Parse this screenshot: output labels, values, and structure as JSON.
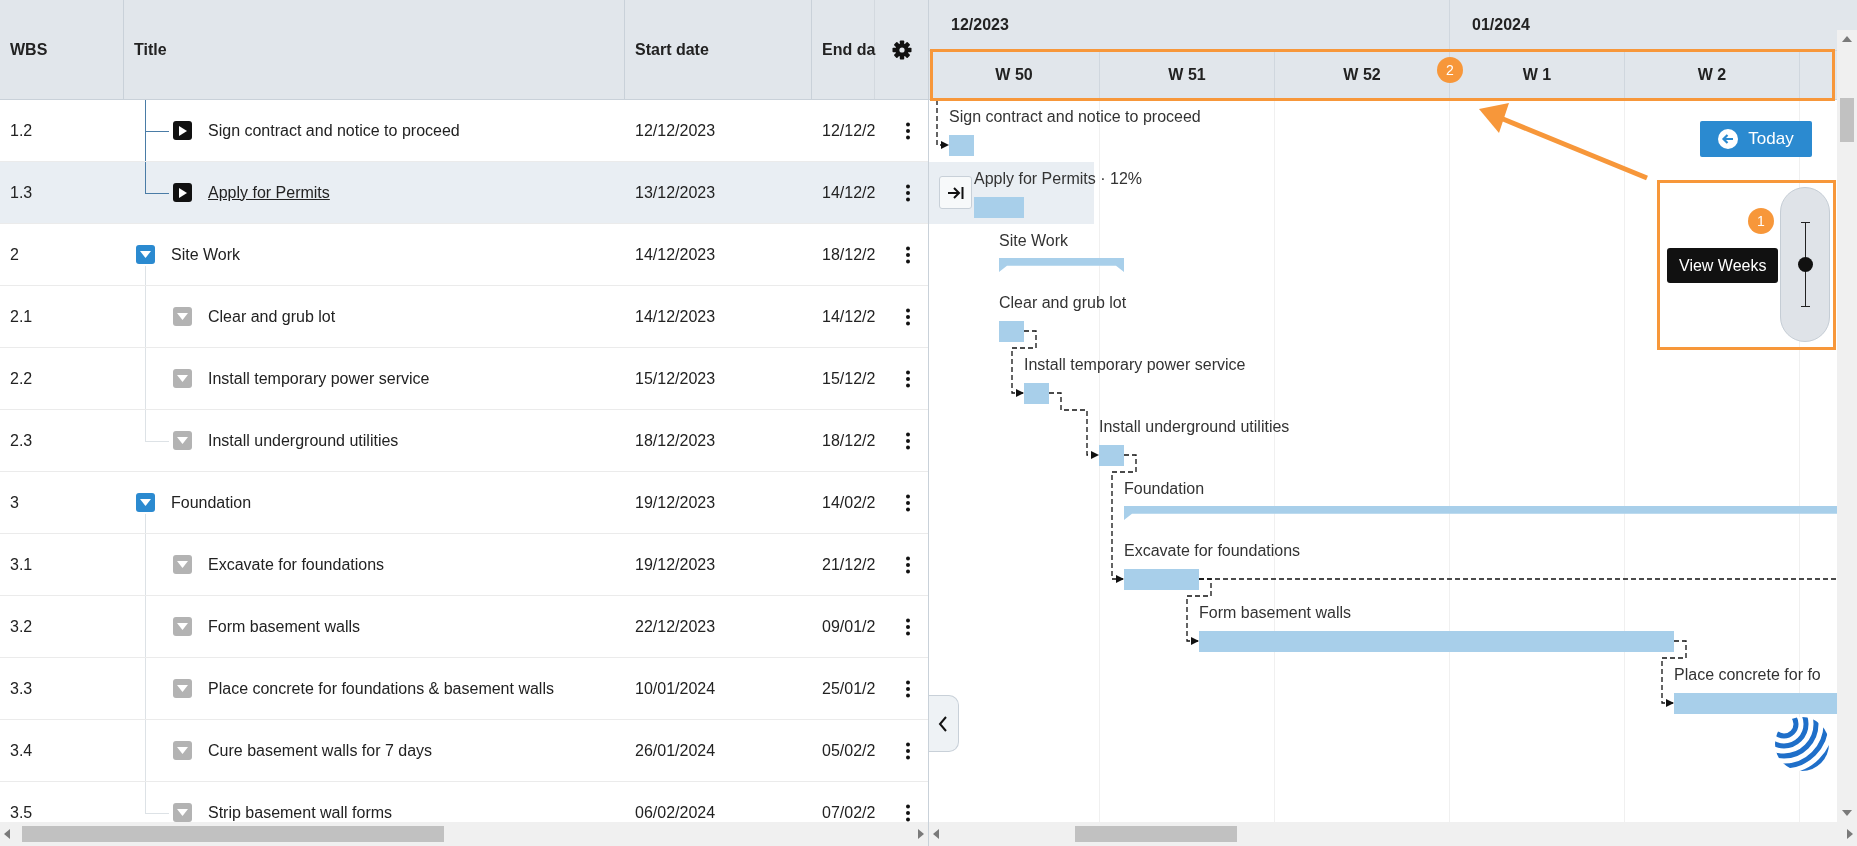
{
  "grid": {
    "columns": [
      {
        "label": "WBS"
      },
      {
        "label": "Title"
      },
      {
        "label": "Start date"
      },
      {
        "label": "End da"
      }
    ]
  },
  "rows": [
    {
      "children": [
        {
          "kind": "task",
          "wbs": "1.2",
          "title": "Sign contract and notice to proceed",
          "start": "12/12/2023",
          "end": "12/12/2",
          "selected": false
        },
        {
          "kind": "task",
          "wbs": "1.3",
          "title": "Apply for Permits",
          "start": "13/12/2023",
          "end": "14/12/2",
          "selected": true
        }
      ]
    },
    {
      "kind": "group",
      "wbs": "2",
      "title": "Site Work",
      "start": "14/12/2023",
      "end": "18/12/2",
      "selected": false,
      "expanded": true,
      "children": [
        {
          "kind": "step",
          "wbs": "2.1",
          "title": "Clear and grub lot",
          "start": "14/12/2023",
          "end": "14/12/2",
          "selected": false
        },
        {
          "kind": "step",
          "wbs": "2.2",
          "title": "Install temporary power service",
          "start": "15/12/2023",
          "end": "15/12/2",
          "selected": false
        },
        {
          "kind": "step",
          "wbs": "2.3",
          "title": "Install underground utilities",
          "start": "18/12/2023",
          "end": "18/12/2",
          "selected": false
        }
      ]
    },
    {
      "kind": "group",
      "wbs": "3",
      "title": "Foundation",
      "start": "19/12/2023",
      "end": "14/02/2",
      "selected": false,
      "expanded": true,
      "children": [
        {
          "kind": "step",
          "wbs": "3.1",
          "title": "Excavate for foundations",
          "start": "19/12/2023",
          "end": "21/12/2",
          "selected": false
        },
        {
          "kind": "step",
          "wbs": "3.2",
          "title": "Form basement walls",
          "start": "22/12/2023",
          "end": "09/01/2",
          "selected": false
        },
        {
          "kind": "step",
          "wbs": "3.3",
          "title": "Place concrete for foundations & basement walls",
          "start": "10/01/2024",
          "end": "25/01/2",
          "selected": false
        },
        {
          "kind": "step",
          "wbs": "3.4",
          "title": "Cure basement walls for 7 days",
          "start": "26/01/2024",
          "end": "05/02/2",
          "selected": false
        },
        {
          "kind": "step",
          "wbs": "3.5",
          "title": "Strip basement wall forms",
          "start": "06/02/2024",
          "end": "07/02/2",
          "selected": false
        }
      ]
    }
  ],
  "gantt": {
    "months": [
      {
        "label": "12/2023"
      },
      {
        "label": "01/2024"
      }
    ],
    "weeks": [
      {
        "label": "W 50"
      },
      {
        "label": "W 51"
      },
      {
        "label": "W 52"
      },
      {
        "label": "W 1"
      },
      {
        "label": "W 2"
      }
    ],
    "week_callout": "2",
    "today_button": {
      "label": "Today"
    },
    "zoom": {
      "tooltip": "View Weeks",
      "level": 0.5,
      "callout": "1"
    },
    "bars": [
      {
        "kind": "task",
        "label": "Sign contract and notice to proceed",
        "incoming_link": true
      },
      {
        "kind": "task",
        "label": "Apply for Permits · 12%",
        "incoming_link": false
      },
      {
        "kind": "summary",
        "label": "Site Work",
        "incoming_link": false
      },
      {
        "kind": "task",
        "label": "Clear and grub lot",
        "incoming_link": false
      },
      {
        "kind": "task",
        "label": "Install temporary power service",
        "incoming_link": true
      },
      {
        "kind": "task",
        "label": "Install underground utilities",
        "incoming_link": true
      },
      {
        "kind": "summary",
        "label": "Foundation",
        "incoming_link": false
      },
      {
        "kind": "task",
        "label": "Excavate for foundations",
        "incoming_link": true,
        "outgoing_link": true
      },
      {
        "kind": "task",
        "label": "Form basement walls",
        "incoming_link": true
      },
      {
        "kind": "task",
        "label": "Place concrete for fo",
        "incoming_link": true
      }
    ]
  }
}
